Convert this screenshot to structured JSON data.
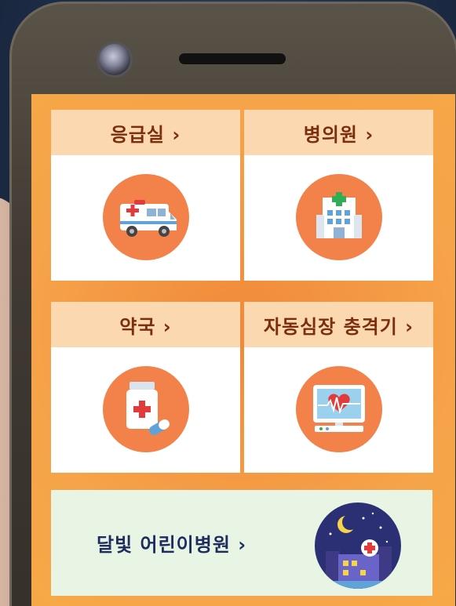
{
  "tiles": {
    "emergency": {
      "label": "응급실 ›",
      "icon": "ambulance-icon"
    },
    "hospital": {
      "label": "병의원 ›",
      "icon": "hospital-icon"
    },
    "pharmacy": {
      "label": "약국 ›",
      "icon": "medicine-icon"
    },
    "aed": {
      "label": "자동심장 충격기 ›",
      "icon": "defibrillator-monitor-icon"
    }
  },
  "night_clinic": {
    "label": "달빛 어린이병원 ›",
    "icon": "night-hospital-icon"
  },
  "colors": {
    "screen_orange": "#f7a142",
    "tile_header": "#fcd8b0",
    "header_text": "#7a2e0e",
    "icon_circle": "#f2824a",
    "night_tile": "#e8f5e4",
    "night_text": "#1e2c5e"
  }
}
